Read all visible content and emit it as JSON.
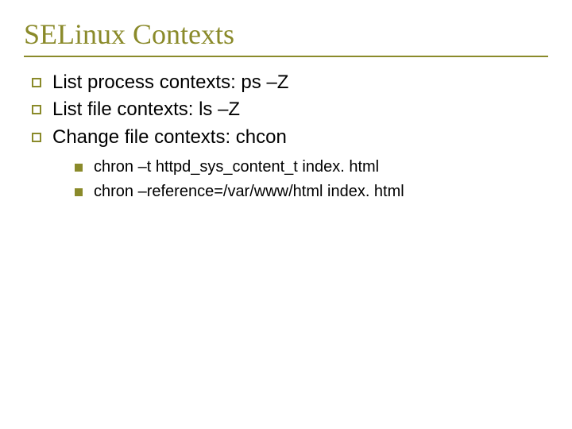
{
  "title": "SELinux Contexts",
  "bullets": [
    {
      "text": "List process contexts: ps –Z"
    },
    {
      "text": "List file contexts:  ls –Z"
    },
    {
      "text": "Change file contexts: chcon"
    }
  ],
  "sub_bullets": [
    {
      "text": "chron –t httpd_sys_content_t index. html"
    },
    {
      "text": "chron –reference=/var/www/html index. html"
    }
  ]
}
